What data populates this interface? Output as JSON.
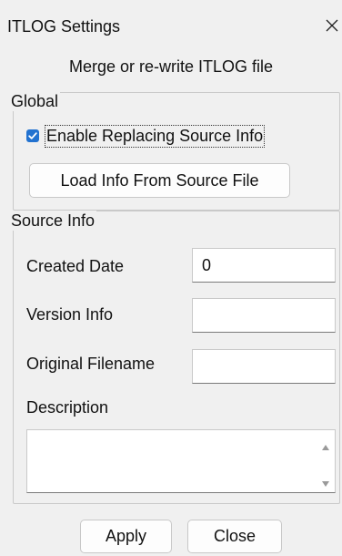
{
  "window": {
    "title": "ITLOG Settings",
    "close_icon": "close-x-icon"
  },
  "subtitle": "Merge or re-write ITLOG file",
  "global_group": {
    "legend": "Global",
    "enable_replacing": {
      "label": "Enable Replacing Source Info",
      "checked": true
    },
    "load_button_label": "Load Info From Source File"
  },
  "source_info_group": {
    "legend": "Source Info",
    "created_date": {
      "label": "Created Date",
      "value": "0"
    },
    "version_info": {
      "label": "Version Info",
      "value": ""
    },
    "original_filename": {
      "label": "Original Filename",
      "value": ""
    },
    "description": {
      "label": "Description",
      "value": ""
    }
  },
  "footer": {
    "apply_label": "Apply",
    "close_label": "Close"
  },
  "colors": {
    "background": "#f0f0f0",
    "accent": "#2272d0"
  }
}
